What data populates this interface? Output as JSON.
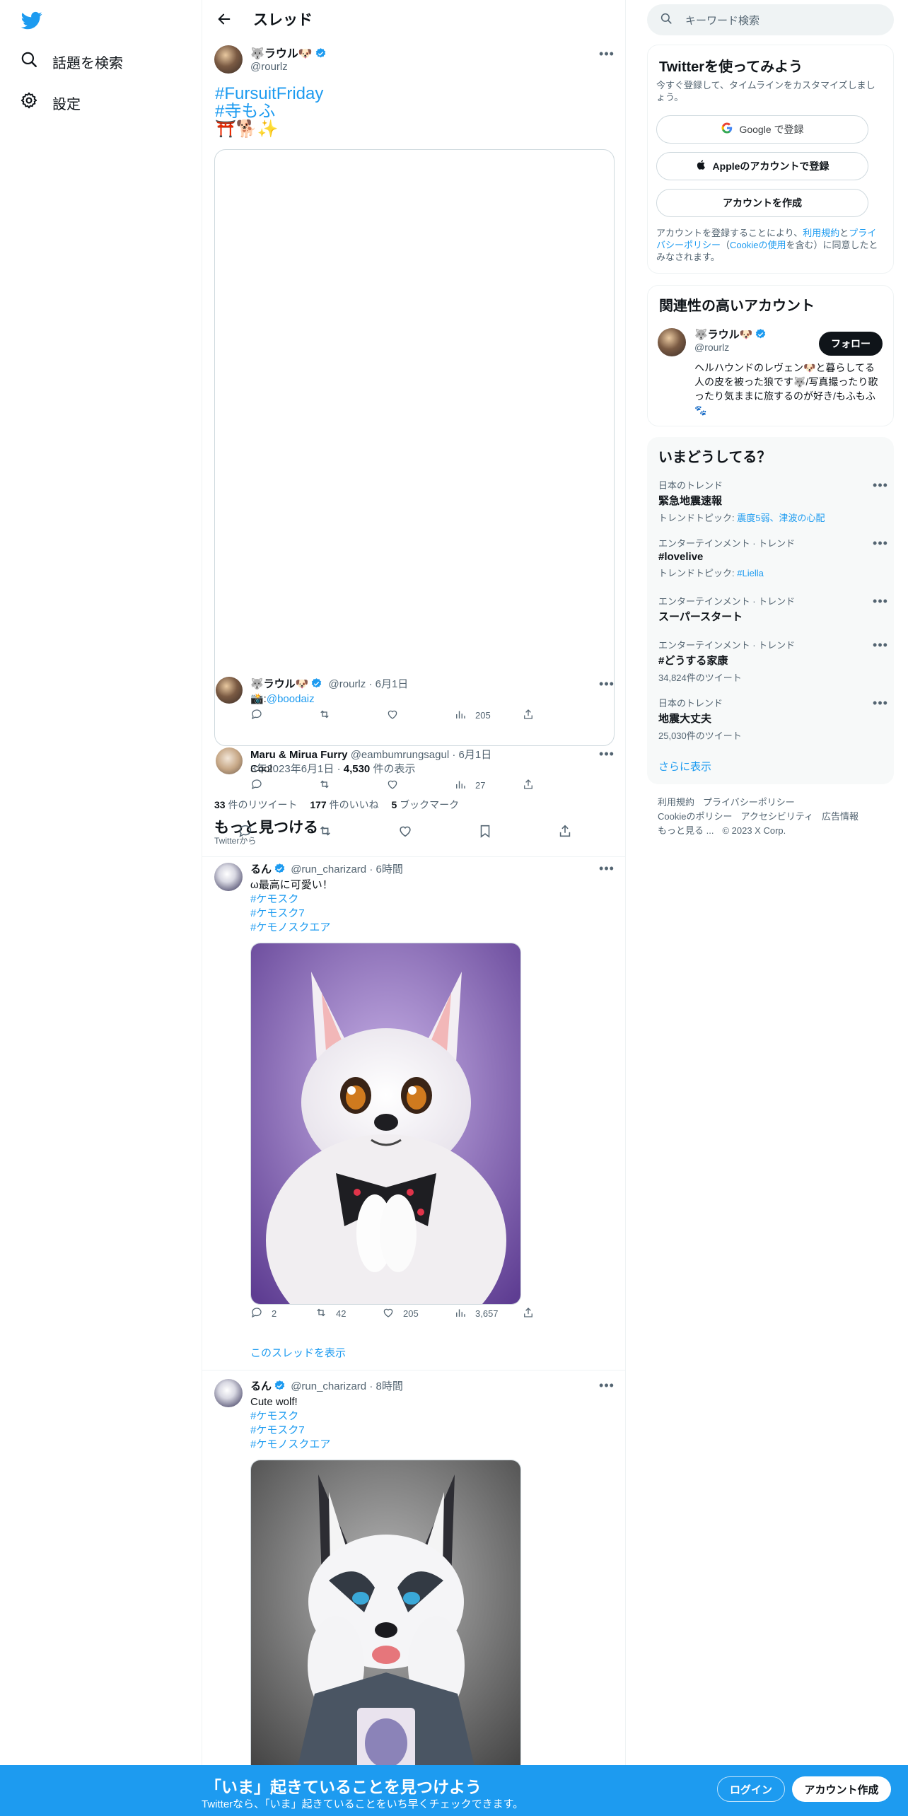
{
  "left_nav": {
    "items": [
      {
        "label": "話題を検索",
        "icon": "search-icon"
      },
      {
        "label": "設定",
        "icon": "gear-icon"
      }
    ]
  },
  "header": {
    "title": "スレッド"
  },
  "main_tweet": {
    "name": "🐺ラウル🐶",
    "handle": "@rourlz",
    "hashtags": [
      "#FursuitFriday",
      "#寺もふ"
    ],
    "emoji_line": "⛩️🐕✨"
  },
  "quoted_tweet": {
    "name": "🐺ラウル🐶",
    "handle": "@rourlz",
    "date": "6月1日",
    "text": "📸:",
    "mention": "@boodaiz",
    "views": "205"
  },
  "reply_tweet": {
    "name": "Maru & Mirua Furry",
    "handle": "@eambumrungsagul",
    "date": "6月1日",
    "text": "Cool",
    "views": "27"
  },
  "main_meta": {
    "time_date": "3年2023年6月1日 ·",
    "views_count": "4,530",
    "views_label": "件の表示"
  },
  "main_stats": {
    "retweets": "33",
    "retweets_label": "件のリツイート",
    "likes": "177",
    "likes_label": "件のいいね",
    "bookmarks": "5",
    "bookmarks_label": "ブックマーク"
  },
  "discover": {
    "title": "もっと見つける",
    "subtitle": "Twitterから"
  },
  "tweets": [
    {
      "name": "るん",
      "handle": "@run_charizard",
      "time": "6時間",
      "text": "ω最高に可愛い！",
      "hashtags": [
        "#ケモスク",
        "#ケモスク7",
        "#ケモノスクエア"
      ],
      "replies": "2",
      "retweets": "42",
      "likes": "205",
      "views": "3,657",
      "show_thread": "このスレッドを表示"
    },
    {
      "name": "るん",
      "handle": "@run_charizard",
      "time": "8時間",
      "text": "Cute wolf!",
      "hashtags": [
        "#ケモスク",
        "#ケモスク7",
        "#ケモノスクエア"
      ]
    }
  ],
  "search": {
    "placeholder": "キーワード検索"
  },
  "signup_panel": {
    "title": "Twitterを使ってみよう",
    "subtitle": "今すぐ登録して、タイムラインをカスタマイズしましょう。",
    "google_label": "Google で登録",
    "apple_label": "Appleのアカウントで登録",
    "create_label": "アカウントを作成",
    "terms_prefix": "アカウントを登録することにより、",
    "terms_link": "利用規約",
    "terms_and": "と",
    "privacy_link": "プライバシーポリシー",
    "cookie_open": "（",
    "cookie_link": "Cookieの使用",
    "terms_suffix": "を含む）に同意したとみなされます。"
  },
  "related": {
    "title": "関連性の高いアカウント",
    "name": "🐺ラウル🐶",
    "handle": "@rourlz",
    "follow_label": "フォロー",
    "bio": "ヘルハウンドのレヴェン🐶と暮らしてる人の皮を被った狼です🐺/写真撮ったり歌ったり気ままに旅するのが好き/もふもふ🐾"
  },
  "trends_panel": {
    "title": "いまどうしてる？",
    "items": [
      {
        "meta": "日本のトレンド",
        "title": "緊急地震速報",
        "sub_prefix": "トレンドトピック: ",
        "sub_link": "震度5弱、津波の心配"
      },
      {
        "meta": "エンターテインメント · トレンド",
        "title": "#lovelive",
        "sub_prefix": "トレンドトピック: ",
        "sub_link": "#Liella"
      },
      {
        "meta": "エンターテインメント · トレンド",
        "title": "スーパースタート",
        "sub_prefix": "",
        "sub_link": ""
      },
      {
        "meta": "エンターテインメント · トレンド",
        "title": "#どうする家康",
        "sub_prefix": "34,824件のツイート",
        "sub_link": ""
      },
      {
        "meta": "日本のトレンド",
        "title": "地震大丈夫",
        "sub_prefix": "25,030件のツイート",
        "sub_link": ""
      }
    ],
    "show_more": "さらに表示"
  },
  "footer": {
    "links": [
      "利用規約",
      "プライバシーポリシー",
      "Cookieのポリシー",
      "アクセシビリティ",
      "広告情報",
      "もっと見る ...",
      "© 2023 X Corp."
    ]
  },
  "banner": {
    "title": "「いま」起きていることを見つけよう",
    "subtitle": "Twitterなら、「いま」起きていることをいち早くチェックできます。",
    "login_label": "ログイン",
    "signup_label": "アカウント作成"
  },
  "colors": {
    "accent": "#1d9bf0",
    "text": "#0f1419",
    "muted": "#536471"
  }
}
